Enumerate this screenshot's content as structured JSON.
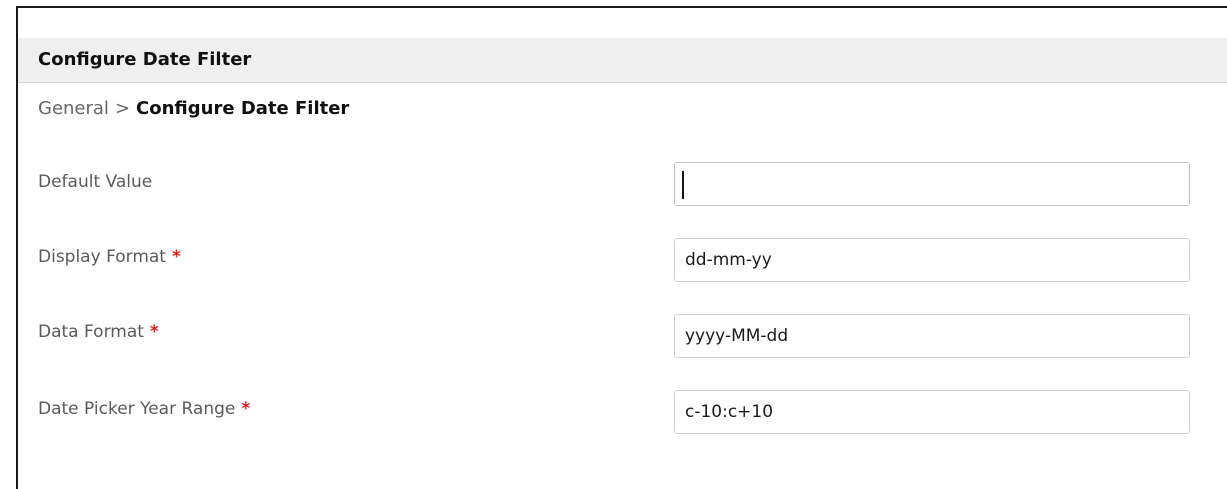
{
  "panel": {
    "title": "Configure Date Filter"
  },
  "breadcrumb": {
    "parent": "General",
    "separator": ">",
    "current": "Configure Date Filter"
  },
  "form": {
    "required_marker": "*",
    "fields": [
      {
        "label": "Default Value",
        "value": "",
        "required": false
      },
      {
        "label": "Display Format",
        "value": "dd-mm-yy",
        "required": true
      },
      {
        "label": "Data Format",
        "value": "yyyy-MM-dd",
        "required": true
      },
      {
        "label": "Date Picker Year Range",
        "value": "c-10:c+10",
        "required": true
      }
    ]
  },
  "colors": {
    "required": "#e02020",
    "header_bg": "#efefef"
  }
}
